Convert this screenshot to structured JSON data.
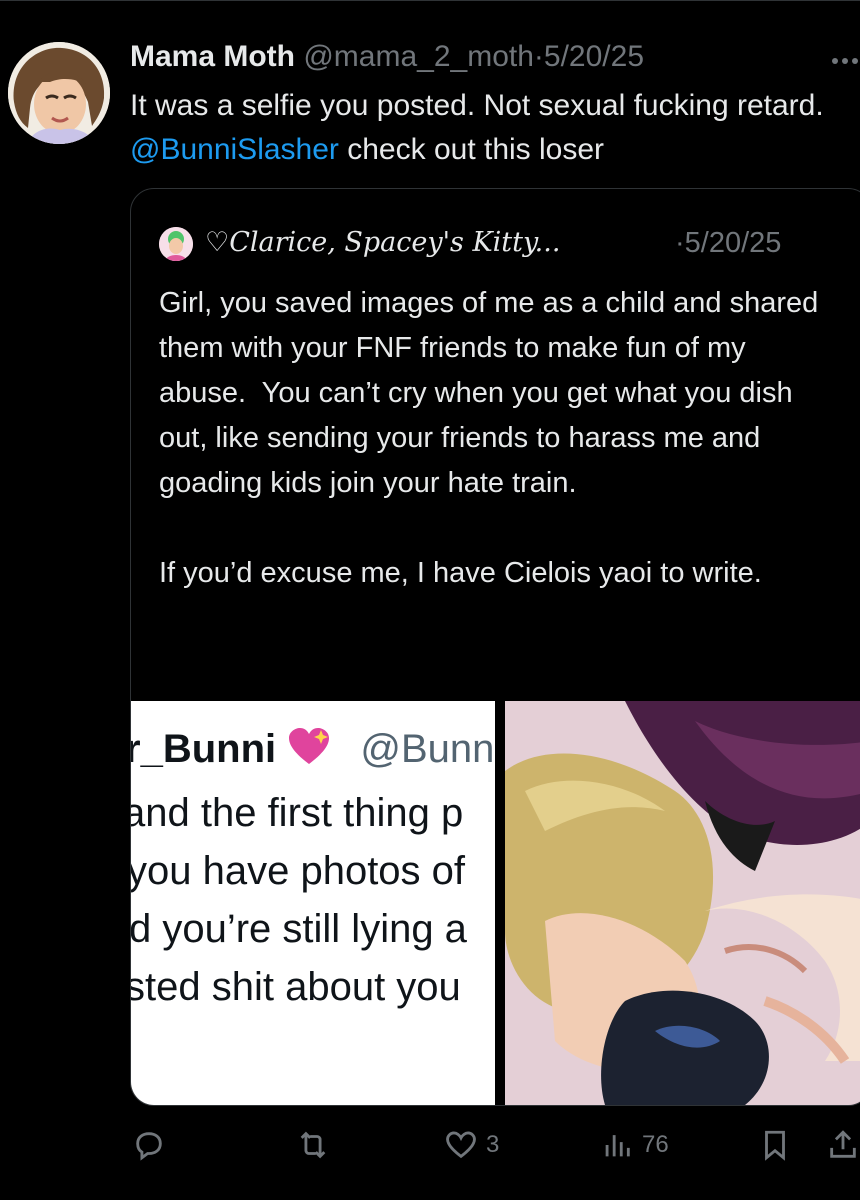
{
  "tweet": {
    "author_name": "Mama Moth",
    "author_handle": "@mama_2_moth",
    "separator": "·",
    "date": "5/20/25",
    "text_part1": "It was a selfie you posted. Not sexual fucking retard. ",
    "mention": "@BunniSlasher",
    "text_part2": " check out this loser"
  },
  "quote": {
    "author_name": "♡Clarice, Spacey's Kitty...",
    "separator": "·",
    "date": "5/20/25",
    "text": "Girl, you saved images of me as a child and shared them with your FNF friends to make fun of my abuse.  You can’t cry when you get what you dish out, like sending your friends to harass me and goading kids join your hate train.\n\nIf you’d excuse me, I have Cielois yaoi to write.",
    "screenshot": {
      "name_fragment": "r_Bunni",
      "handle_fragment": "@Bunni",
      "lines": [
        "and the first thing p",
        "you have photos of",
        "d you’re still lying a",
        "sted shit about you"
      ]
    }
  },
  "actions": {
    "reply_count": "",
    "retweet_count": "",
    "like_count": "3",
    "views_count": "76"
  },
  "icons": {
    "more": "more-icon",
    "reply": "reply-icon",
    "retweet": "retweet-icon",
    "like": "heart-icon",
    "views": "views-icon",
    "bookmark": "bookmark-icon",
    "share": "share-icon"
  },
  "colors": {
    "background": "#000000",
    "text": "#e7e9ea",
    "muted": "#71767b",
    "link": "#1d9bf0",
    "border": "#2f3336"
  }
}
